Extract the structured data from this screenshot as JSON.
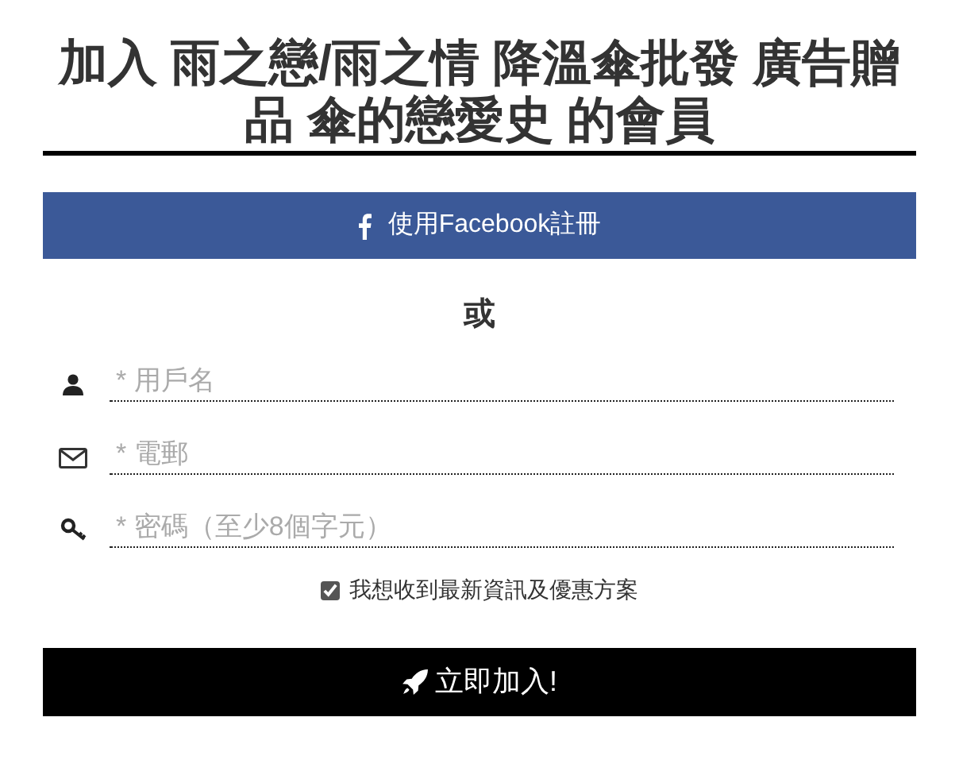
{
  "title": "加入 雨之戀/雨之情 降溫傘批發 廣告贈品 傘的戀愛史 的會員",
  "facebook_button": {
    "label": "使用Facebook註冊"
  },
  "separator": "或",
  "fields": [
    {
      "kind": "user",
      "placeholder": "* 用戶名"
    },
    {
      "kind": "email",
      "placeholder": "* 電郵"
    },
    {
      "kind": "password",
      "placeholder": "* 密碼（至少8個字元）"
    }
  ],
  "newsletter": {
    "label": "我想收到最新資訊及優惠方案",
    "checked": true
  },
  "submit_button": {
    "label": "立即加入!"
  }
}
